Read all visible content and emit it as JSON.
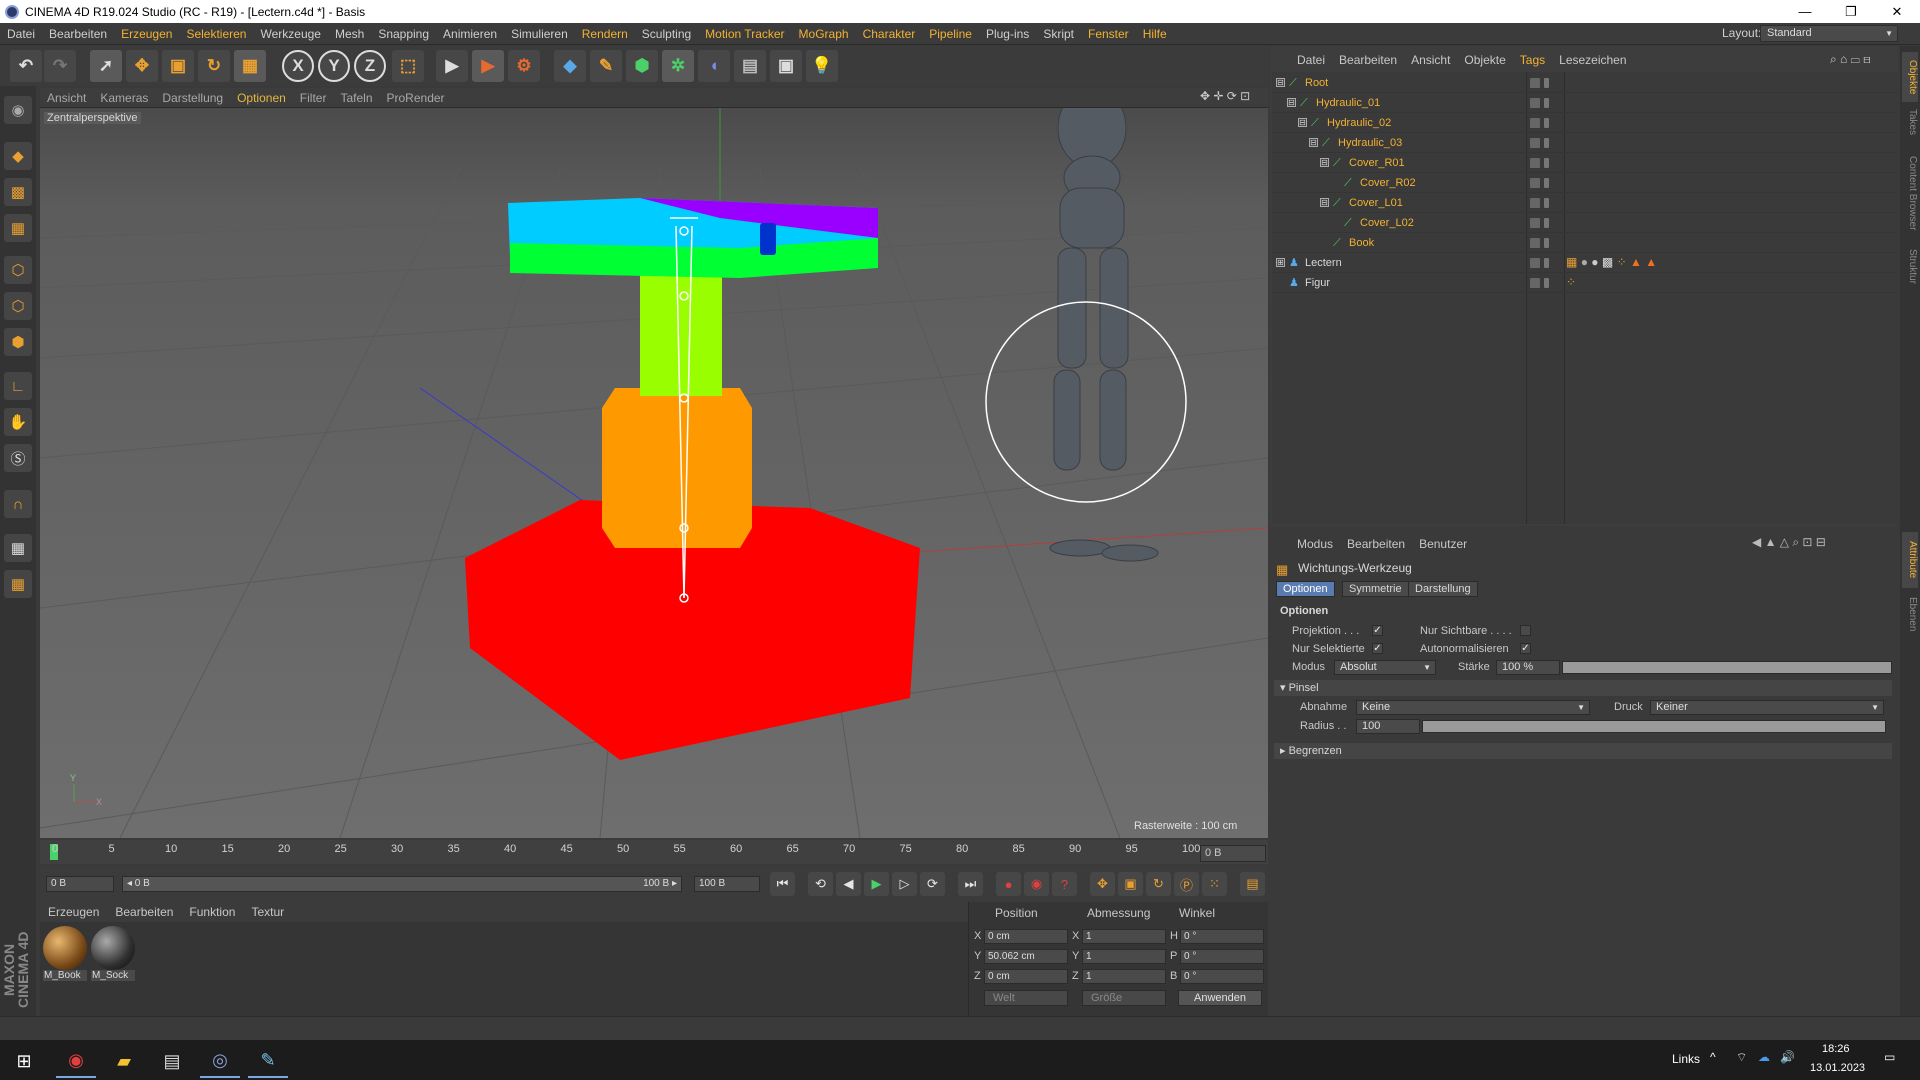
{
  "window": {
    "title": "CINEMA 4D R19.024 Studio (RC - R19) - [Lectern.c4d *] - Basis",
    "minimize": "—",
    "maximize": "❐",
    "close": "✕"
  },
  "menu": [
    "Datei",
    "Bearbeiten",
    "Erzeugen",
    "Selektieren",
    "Werkzeuge",
    "Mesh",
    "Snapping",
    "Animieren",
    "Simulieren",
    "Rendern",
    "Sculpting",
    "Motion Tracker",
    "MoGraph",
    "Charakter",
    "Pipeline",
    "Plug-ins",
    "Skript",
    "Fenster",
    "Hilfe"
  ],
  "menu_highlight": [
    "Erzeugen",
    "Selektieren",
    "Rendern",
    "Motion Tracker",
    "MoGraph",
    "Charakter",
    "Pipeline",
    "Fenster",
    "Hilfe"
  ],
  "layout": {
    "label": "Layout:",
    "value": "Standard"
  },
  "toolbar": {
    "x_label": "X",
    "y_label": "Y",
    "z_label": "Z"
  },
  "viewport": {
    "menu": [
      "Ansicht",
      "Kameras",
      "Darstellung",
      "Optionen",
      "Filter",
      "Tafeln",
      "ProRender"
    ],
    "active_menu": "Optionen",
    "camera_label": "Zentralperspektive",
    "raster": "Rasterweite : 100 cm",
    "axis_y": "Y",
    "axis_x": "X"
  },
  "timeline": {
    "ticks": [
      "0",
      "5",
      "10",
      "15",
      "20",
      "25",
      "30",
      "35",
      "40",
      "45",
      "50",
      "55",
      "60",
      "65",
      "70",
      "75",
      "80",
      "85",
      "90",
      "95",
      "100"
    ],
    "current_frame": "0 B",
    "start": "0 B",
    "range_start": "◂ 0 B",
    "range_end": "100 B ▸",
    "end": "100 B"
  },
  "materials": {
    "menu": [
      "Erzeugen",
      "Bearbeiten",
      "Funktion",
      "Textur"
    ],
    "items": [
      {
        "label": "M_Book"
      },
      {
        "label": "M_Sock"
      }
    ]
  },
  "coordinates": {
    "headers": [
      "Position",
      "Abmessung",
      "Winkel"
    ],
    "rows": [
      {
        "axis": "X",
        "pos": "0 cm",
        "size_axis": "X",
        "size": "1",
        "rot_axis": "H",
        "rot": "0 °"
      },
      {
        "axis": "Y",
        "pos": "50.062 cm",
        "size_axis": "Y",
        "size": "1",
        "rot_axis": "P",
        "rot": "0 °"
      },
      {
        "axis": "Z",
        "pos": "0 cm",
        "size_axis": "Z",
        "size": "1",
        "rot_axis": "B",
        "rot": "0 °"
      }
    ],
    "space": "Welt",
    "size_mode": "Größe",
    "apply": "Anwenden"
  },
  "brand": "MAXON CINEMA 4D",
  "object_manager": {
    "menu": [
      "Datei",
      "Bearbeiten",
      "Ansicht",
      "Objekte",
      "Tags",
      "Lesezeichen"
    ],
    "active_menu": "Tags",
    "objects": [
      {
        "name": "Root",
        "depth": 0,
        "toggle": "⊟",
        "icon": "bone-icon"
      },
      {
        "name": "Hydraulic_01",
        "depth": 1,
        "toggle": "⊟",
        "icon": "bone-icon"
      },
      {
        "name": "Hydraulic_02",
        "depth": 2,
        "toggle": "⊟",
        "icon": "bone-icon"
      },
      {
        "name": "Hydraulic_03",
        "depth": 3,
        "toggle": "⊟",
        "icon": "bone-icon"
      },
      {
        "name": "Cover_R01",
        "depth": 4,
        "toggle": "⊟",
        "icon": "bone-icon"
      },
      {
        "name": "Cover_R02",
        "depth": 5,
        "toggle": "",
        "icon": "bone-icon"
      },
      {
        "name": "Cover_L01",
        "depth": 4,
        "toggle": "⊟",
        "icon": "bone-icon"
      },
      {
        "name": "Cover_L02",
        "depth": 5,
        "toggle": "",
        "icon": "bone-icon"
      },
      {
        "name": "Book",
        "depth": 4,
        "toggle": "",
        "icon": "bone-icon"
      },
      {
        "name": "Lectern",
        "depth": 0,
        "toggle": "⊞",
        "icon": "figure-icon"
      },
      {
        "name": "Figur",
        "depth": 0,
        "toggle": "",
        "icon": "figure-icon"
      }
    ]
  },
  "attributes": {
    "menu": [
      "Modus",
      "Bearbeiten",
      "Benutzer"
    ],
    "tool_title": "Wichtungs-Werkzeug",
    "tabs": [
      "Optionen",
      "Symmetrie",
      "Darstellung"
    ],
    "active_tab": "Optionen",
    "section_options": "Optionen",
    "projection": "Projektion . . .",
    "only_visible": "Nur Sichtbare . . . .",
    "only_selected": "Nur Selektierte",
    "auto_normalize": "Autonormalisieren",
    "checkmark": "✓",
    "mode_label": "Modus",
    "mode_value": "Absolut",
    "strength_label": "Stärke",
    "strength_value": "100 %",
    "strength_fraction": 1.0,
    "brush_section": "Pinsel",
    "falloff_label": "Abnahme",
    "falloff_value": "Keine",
    "pressure_label": "Druck",
    "pressure_value": "Keiner",
    "radius_label": "Radius . .",
    "radius_value": "100",
    "limits_section": "Begrenzen"
  },
  "right_tabs": [
    "Objekte",
    "Takes",
    "Content Browser",
    "Struktur",
    "Attribute",
    "Ebenen"
  ],
  "taskbar": {
    "links": "Links",
    "time": "18:26",
    "date": "13.01.2023"
  },
  "colors": {
    "accent": "#f2b233",
    "bone": "#4cd06a",
    "active_tab": "#5a7bb0"
  }
}
